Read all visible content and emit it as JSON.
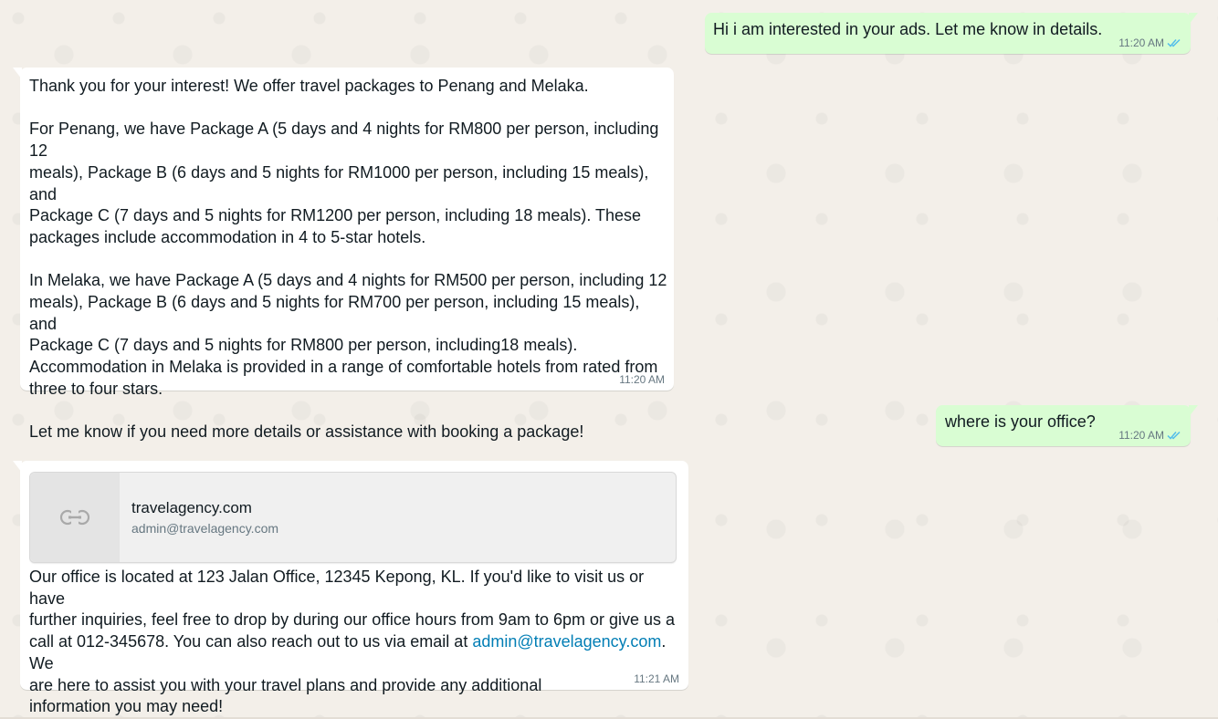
{
  "messages": [
    {
      "direction": "outgoing",
      "text": "Hi i am interested in your ads. Let me know in details.",
      "time": "11:20 AM",
      "status": "read"
    },
    {
      "direction": "incoming",
      "text": "Thank you for your interest! We offer travel packages to Penang and Melaka.\n\nFor Penang, we have Package A (5 days and 4 nights for RM800 per person, including 12\nmeals), Package B (6 days and 5 nights for RM1000 per person, including 15 meals), and\nPackage C (7 days and 5 nights for RM1200 per person, including 18 meals). These\npackages include accommodation in 4 to 5-star hotels.\n\nIn Melaka, we have Package A (5 days and 4 nights for RM500 per person, including 12\nmeals), Package B (6 days and 5 nights for RM700 per person, including 15 meals), and\nPackage C (7 days and 5 nights for RM800 per person, including18 meals).\nAccommodation in Melaka is provided in a range of comfortable hotels from rated from\nthree to four stars.\n\nLet me know if you need more details or assistance with booking a package!",
      "time": "11:20 AM"
    },
    {
      "direction": "outgoing",
      "text": "where is your office?",
      "time": "11:20 AM",
      "status": "read"
    },
    {
      "direction": "incoming",
      "link_preview": {
        "title": "travelagency.com",
        "subtitle": "admin@travelagency.com",
        "icon": "link-icon"
      },
      "text_before_link": "Our office is located at 123 Jalan Office, 12345 Kepong, KL. If you'd like to visit us or have\nfurther inquiries, feel free to drop by during our office hours from 9am to 6pm or give us a\ncall at 012-345678. You can also reach out to us via email at ",
      "link_text": "admin@travelagency.com",
      "text_after_link": ". We\nare here to assist you with your travel plans and provide any additional\ninformation you may need!",
      "time": "11:21 AM"
    }
  ],
  "colors": {
    "outgoing_bubble": "#d9fdd3",
    "incoming_bubble": "#ffffff",
    "read_ticks": "#53bdeb",
    "link": "#027eb5",
    "wallpaper": "#efeae2"
  }
}
